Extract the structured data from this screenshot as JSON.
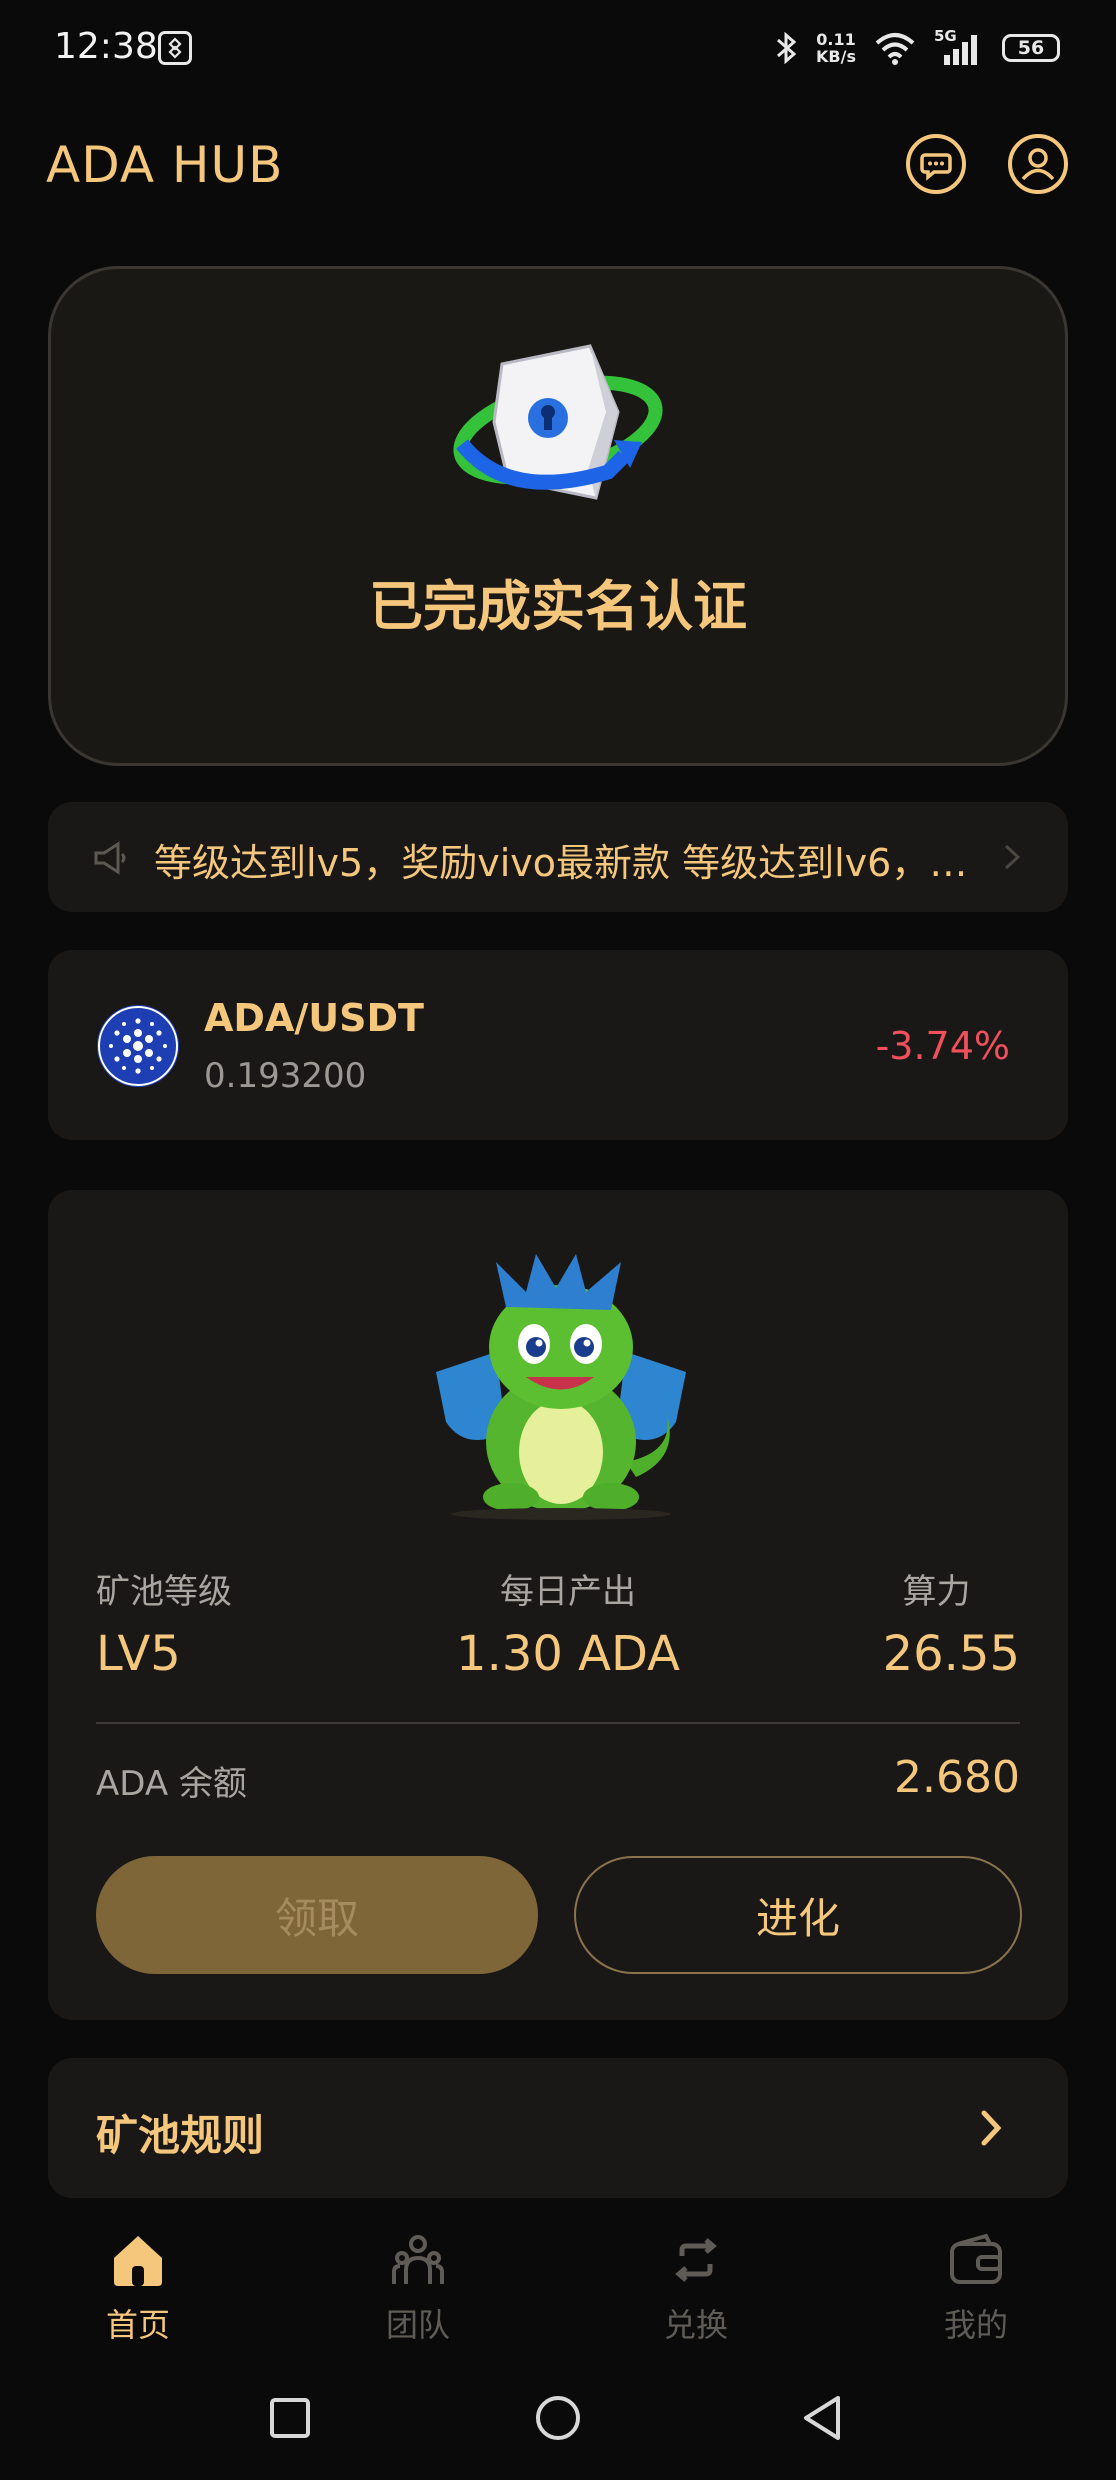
{
  "status_bar": {
    "time": "12:38",
    "net_speed_value": "0.11",
    "net_speed_unit": "KB/s",
    "network": "5G",
    "battery": "56"
  },
  "header": {
    "title": "ADA HUB",
    "message_icon": "message-icon",
    "profile_icon": "user-icon"
  },
  "verification": {
    "text": "已完成实名认证"
  },
  "notice": {
    "text": "等级达到lv5，奖励vivo最新款 等级达到lv6，奖..."
  },
  "ticker": {
    "pair": "ADA/USDT",
    "price": "0.193200",
    "change": "-3.74%"
  },
  "mining": {
    "level_label": "矿池等级",
    "level_value": "LV5",
    "daily_label": "每日产出",
    "daily_value": "1.30 ADA",
    "power_label": "算力",
    "power_value": "26.55",
    "balance_label": "ADA 余额",
    "balance_value": "2.680",
    "claim_label": "领取",
    "evolve_label": "进化"
  },
  "rules": {
    "label": "矿池规则"
  },
  "tabs": [
    {
      "label": "首页",
      "icon": "home-icon",
      "active": true
    },
    {
      "label": "团队",
      "icon": "team-icon",
      "active": false
    },
    {
      "label": "兑换",
      "icon": "exchange-icon",
      "active": false
    },
    {
      "label": "我的",
      "icon": "wallet-icon",
      "active": false
    }
  ],
  "colors": {
    "accent": "#f5c77d",
    "negative": "#f0505c",
    "card": "#1a1816",
    "background": "#0b0a0a"
  }
}
